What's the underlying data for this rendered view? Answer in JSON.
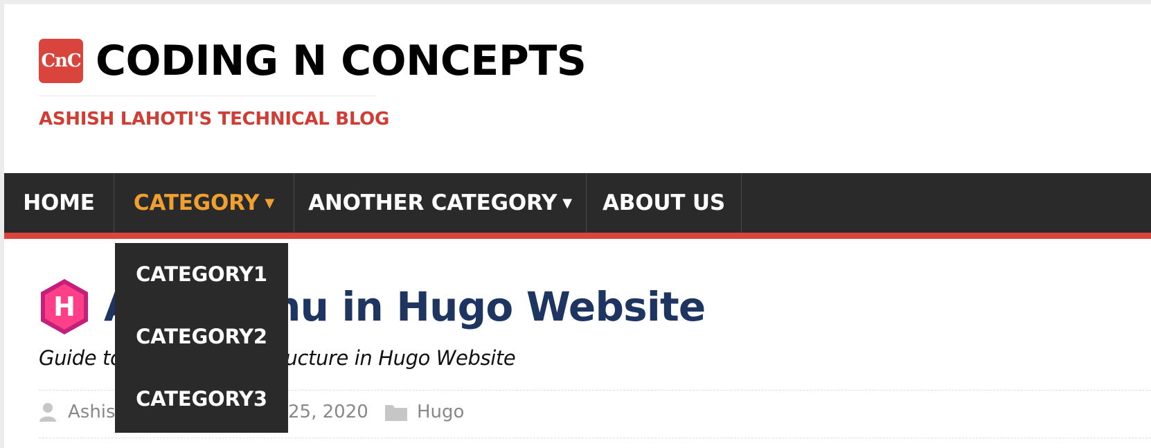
{
  "header": {
    "logo_text": "CnC",
    "title": "CODING N CONCEPTS",
    "tagline": "ASHISH LAHOTI'S TECHNICAL BLOG"
  },
  "nav": {
    "items": [
      {
        "label": "HOME"
      },
      {
        "label": "CATEGORY",
        "has_dropdown": true,
        "active": true
      },
      {
        "label": "ANOTHER CATEGORY",
        "has_dropdown": true
      },
      {
        "label": "ABOUT US"
      }
    ],
    "caret": "▼"
  },
  "dropdown": {
    "items": [
      "CATEGORY1",
      "CATEGORY2",
      "CATEGORY3"
    ]
  },
  "article": {
    "icon": "hugo-icon",
    "title": "Add menu in Hugo Website",
    "subtitle": "Guide to create menu structure in Hugo Website",
    "meta": {
      "author": "Ashish",
      "date": "25, 2020",
      "category": "Hugo"
    }
  },
  "colors": {
    "accent": "#d9443c",
    "nav_bg": "#2a2a2a",
    "active": "#f0a030",
    "title": "#1d3560"
  }
}
